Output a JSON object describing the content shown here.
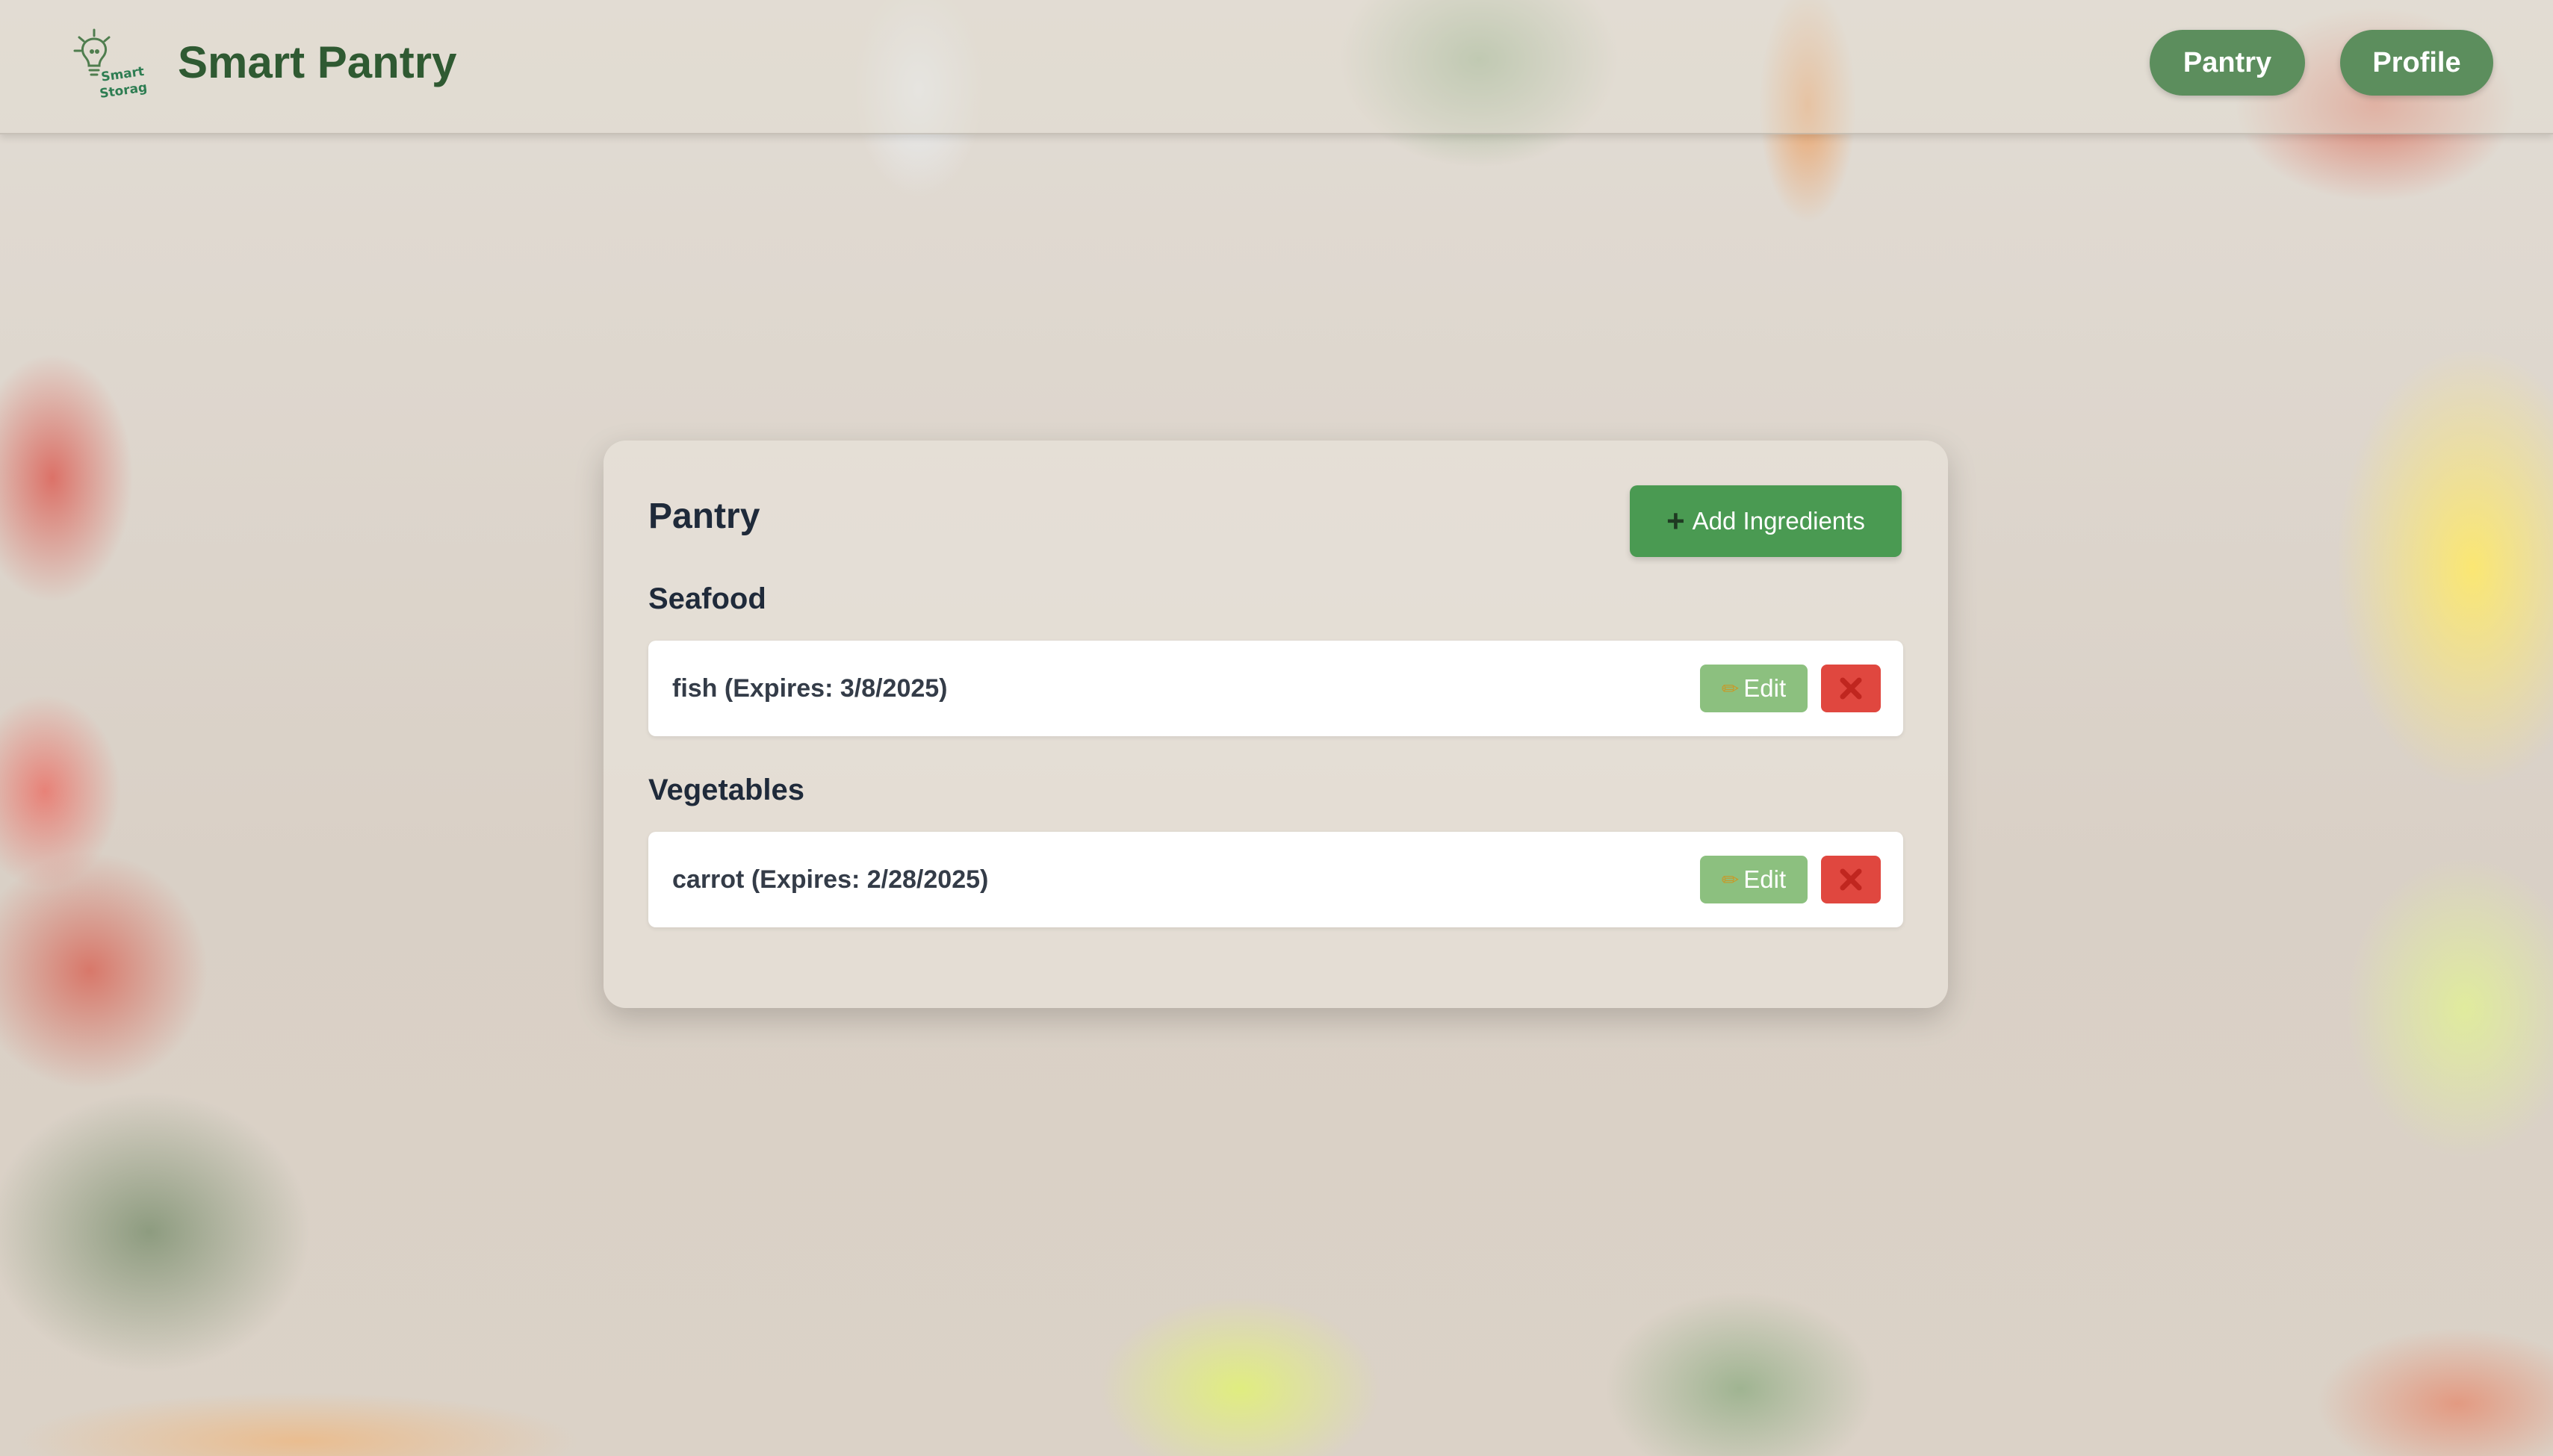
{
  "app": {
    "title": "Smart Pantry",
    "logo_text": "Smart Storage"
  },
  "nav": {
    "pantry_label": "Pantry",
    "profile_label": "Profile"
  },
  "pantry": {
    "heading": "Pantry",
    "add_button_icon": "plus-icon",
    "add_button_label": "Add Ingredients",
    "categories": [
      {
        "name": "Seafood",
        "items": [
          {
            "text": "fish (Expires: 3/8/2025)",
            "edit_label": "Edit",
            "edit_icon": "pencil-icon",
            "delete_icon": "close-icon"
          }
        ]
      },
      {
        "name": "Vegetables",
        "items": [
          {
            "text": "carrot (Expires: 2/28/2025)",
            "edit_label": "Edit",
            "edit_icon": "pencil-icon",
            "delete_icon": "close-icon"
          }
        ]
      }
    ]
  },
  "colors": {
    "brand_green": "#2f5a32",
    "nav_button": "#5c8e5d",
    "add_button": "#4a9a52",
    "edit_button": "#8cc07f",
    "delete_button": "#e0473f"
  }
}
